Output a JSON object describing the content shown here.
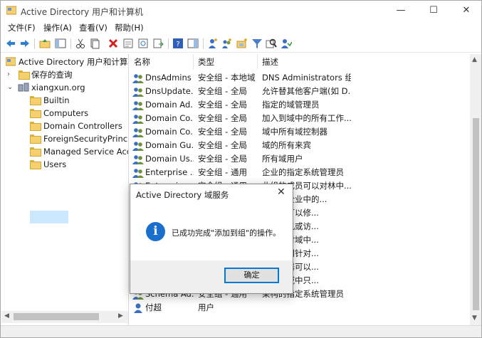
{
  "window": {
    "title": "Active Directory 用户和计算机",
    "buttons": [
      "—",
      "☐",
      "✕"
    ]
  },
  "menu": [
    "文件(F)",
    "操作(A)",
    "查看(V)",
    "帮助(H)"
  ],
  "toolbar_icons": [
    "back-arrow-icon",
    "forward-arrow-icon",
    "up-folder-icon",
    "show-console-tree-icon",
    "cut-icon",
    "copy-icon",
    "delete-icon",
    "properties-icon",
    "refresh-icon",
    "export-list-icon",
    "help-icon",
    "show-hide-icon",
    "new-user-icon",
    "new-group-icon",
    "new-ou-icon",
    "filter-icon",
    "find-icon",
    "add-to-group-icon"
  ],
  "tree": {
    "root": "Active Directory 用户和计算机",
    "saved_queries": "保存的查询",
    "domain": "xiangxun.org",
    "containers": [
      "Builtin",
      "Computers",
      "Domain Controllers",
      "ForeignSecurityPrincipals",
      "Managed Service Accounts",
      "Users"
    ],
    "selected": "Users"
  },
  "columns": {
    "name": "名称",
    "type": "类型",
    "description": "描述"
  },
  "rows": [
    {
      "name": "DnsAdmins",
      "type": "安全组 - 本地域",
      "description": "DNS Administrators 组"
    },
    {
      "name": "DnsUpdateProxy",
      "type": "安全组 - 全局",
      "description": "允许替其他客户端(如 DHCP 服务器)..."
    },
    {
      "name": "Domain Admins",
      "type": "安全组 - 全局",
      "description": "指定的域管理员"
    },
    {
      "name": "Domain Computers",
      "type": "安全组 - 全局",
      "description": "加入到域中的所有工作站和服务器"
    },
    {
      "name": "Domain Controllers",
      "type": "安全组 - 全局",
      "description": "域中所有域控制器"
    },
    {
      "name": "Domain Guests",
      "type": "安全组 - 全局",
      "description": "域的所有来宾"
    },
    {
      "name": "Domain Users",
      "type": "安全组 - 全局",
      "description": "所有域用户"
    },
    {
      "name": "Enterprise Admins",
      "type": "安全组 - 通用",
      "description": "企业的指定系统管理员"
    },
    {
      "name": "Enterprise Key Admins",
      "type": "安全组 - 通用",
      "description": "此组的成员可以对林中..."
    },
    {
      "name": "",
      "type": "",
      "description": "成员是企业中的..."
    },
    {
      "name": "",
      "type": "",
      "description": "的成员可以修..."
    },
    {
      "name": "",
      "type": "",
      "description": "问计算机或访..."
    },
    {
      "name": "",
      "type": "",
      "description": "员可以对域中..."
    },
    {
      "name": "",
      "type": "",
      "description": "员将受到针对..."
    },
    {
      "name": "",
      "type": "",
      "description": "的服务器可以..."
    },
    {
      "name": "",
      "type": "",
      "description": "成员是域中只..."
    },
    {
      "name": "Schema Admins",
      "type": "安全组 - 通用",
      "description": "架构的指定系统管理员"
    },
    {
      "name": "付超",
      "type": "用户",
      "description": ""
    }
  ],
  "row_display_names": [
    "DnsAdmins",
    "DnsUpdate...",
    "Domain Ad...",
    "Domain Co...",
    "Domain Co...",
    "Domain Gu...",
    "Domain Us...",
    "Enterprise ...",
    "Enterpris...",
    "",
    "",
    "",
    "",
    "",
    "",
    "",
    "Schema Ad...",
    "付超"
  ],
  "row_display_descriptions": [
    "DNS Administrators 组",
    "允许替其他客户端(如 D...",
    "指定的域管理员",
    "加入到域中的所有工作...",
    "域中所有域控制器",
    "域的所有来宾",
    "所有域用户",
    "企业的指定系统管理员",
    "此组的成员可以对林中...",
    "成员是企业中的...",
    "的成员可以修...",
    "问计算机或访...",
    "员可以对域中...",
    "员将受到针对...",
    "的服务器可以...",
    "成员是域中只...",
    "架构的指定系统管理员",
    ""
  ],
  "dialog": {
    "title": "Active Directory 域服务",
    "message": "已成功完成\"添加到组\"的操作。",
    "ok_label": "确定",
    "close": "✕"
  }
}
